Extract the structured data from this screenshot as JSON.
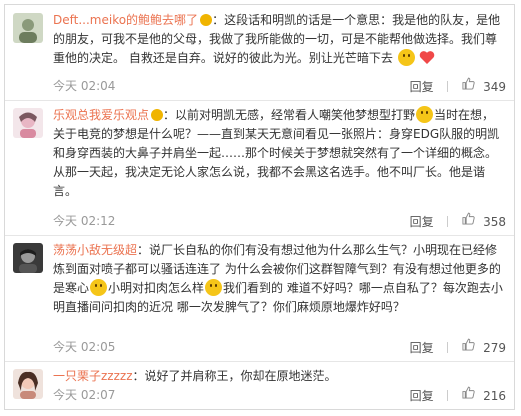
{
  "comments": [
    {
      "user": "Deft...meiko的鲍鲍去哪了",
      "text_a": "这段话和明凯的话是一个意思：我是他的队友，是他的朋友，可我不是他的父母，我做了我所能做的一切，可是不能帮他做选择。我们尊重他的决定。      自救还是自弃。说好的彼此为光。别让光芒暗下去",
      "time": "今天 02:04",
      "reply": "回复",
      "likes": "349"
    },
    {
      "user": "乐观总我爱乐观点",
      "text_a": "以前对明凯无感，经常看人嘲笑他梦想型打野",
      "text_b": "当时在想，关于电竞的梦想是什么呢？——直到某天无意间看见一张照片：身穿EDG队服的明凯和身穿西装的大鼻子并肩坐一起……那个时候关于梦想就突然有了一个详细的概念。从那一天起，我决定无论人家怎么说，我都不会黑这名选手。他不叫厂长。他是谐言。",
      "time": "今天 02:12",
      "reply": "回复",
      "likes": "358"
    },
    {
      "user": "荡荡小敌无级超",
      "text_a": "说厂长自私的你们有没有想过他为什么那么生气？小明现在已经修炼到面对喷子都可以骚话连连了 为什么会被你们这群智障气到？有没有想过他更多的是寒心",
      "text_b": "小明对扣肉怎么样",
      "text_c": "我们看到的 难道不好吗？哪一点自私了？每次跑去小明直播间问扣肉的近况 哪一次发脾气了？你们麻烦原地爆炸好吗？",
      "time": "今天 02:05",
      "reply": "回复",
      "likes": "279"
    },
    {
      "user": "一只栗子zzzzz",
      "text_a": "说好了并肩称王，你却在原地迷茫。",
      "time": "今天 02:07",
      "reply": "回复",
      "likes": "216"
    }
  ]
}
